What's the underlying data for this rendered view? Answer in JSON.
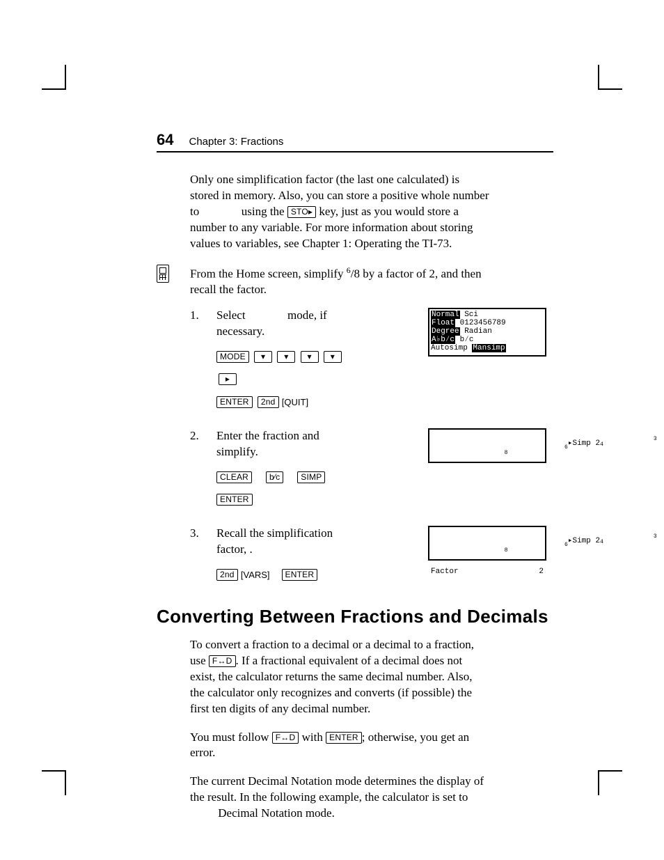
{
  "page_number": "64",
  "chapter_label": "Chapter 3: Fractions",
  "intro_paragraph": "Only one simplification factor (the last one calculated) is stored in memory. Also, you can store a positive whole number to ",
  "intro_paragraph_2": " using the ",
  "intro_paragraph_3": " key, just as you would store a number to any variable. For more information about storing values to variables, see Chapter 1: Operating the TI-73.",
  "example_intro_a": "From the Home screen, simplify ",
  "example_fraction_num": "6",
  "example_fraction_den": "8",
  "example_intro_b": " by a factor of 2, and then recall the factor.",
  "steps": [
    {
      "n": "1.",
      "text_a": "Select ",
      "text_b": " mode, if necessary.",
      "keys_line1": [
        "MODE",
        "▾",
        "▾",
        "▾",
        "▾",
        "▸"
      ],
      "keys_line2": [
        "ENTER",
        "2nd"
      ],
      "keys_line2_text": "[QUIT]",
      "screen": {
        "rows": [
          {
            "hl": "Normal",
            "rest": " Sci"
          },
          {
            "hl": "Float",
            "rest": " 0123456789"
          },
          {
            "hl": "Degree",
            "rest": " Radian"
          },
          {
            "hl": "A♭b⁄c",
            "rest": " b⁄c"
          },
          {
            "plain": "Autosimp ",
            "hl2": "Mansimp"
          }
        ],
        "kind": "big"
      }
    },
    {
      "n": "2.",
      "text_a": "Enter the fraction and simplify.",
      "keys_line1": [
        "CLEAR"
      ],
      "keys_line1_gap": true,
      "keys_line1b": [
        "b⁄c"
      ],
      "keys_line1_gap2": true,
      "keys_line1c": [
        "SIMP"
      ],
      "keys_line2": [
        "ENTER"
      ],
      "screen": {
        "left_tiny_top": "6",
        "left_tiny_bot": "8",
        "main": "▸Simp 2",
        "right_tiny_top": "3",
        "right_tiny_bot": "4",
        "kind": "small"
      }
    },
    {
      "n": "3.",
      "text_a": "Recall the simplification factor,  .",
      "keys_line1": [
        "2nd"
      ],
      "keys_line1_text": "[VARS]",
      "keys_line1_gap": true,
      "keys_line1b": [
        "ENTER"
      ],
      "screen": {
        "left_tiny_top": "6",
        "left_tiny_bot": "8",
        "main": "▸Simp 2",
        "right_tiny_top": "3",
        "right_tiny_bot": "4",
        "line2": "Factor",
        "line2_right": "2",
        "kind": "small"
      }
    }
  ],
  "section_heading": "Converting Between Fractions and Decimals",
  "body2_a": "To convert a fraction to a decimal or a decimal to a fraction, use ",
  "body2_b": ". If a fractional equivalent of a decimal does not exist, the calculator returns the same decimal number. Also, the calculator only recognizes and converts (if possible) the first ten digits of any decimal number.",
  "body3_a": "You must follow ",
  "body3_b": " with ",
  "body3_c": "; otherwise, you get an error.",
  "body4_a": "The current Decimal Notation mode determines the display of the result. In the following example, the calculator is set to ",
  "body4_b": " Decimal Notation mode.",
  "keycaps": {
    "sto": "STO▸",
    "fd": "F↔D",
    "enter": "ENTER"
  }
}
